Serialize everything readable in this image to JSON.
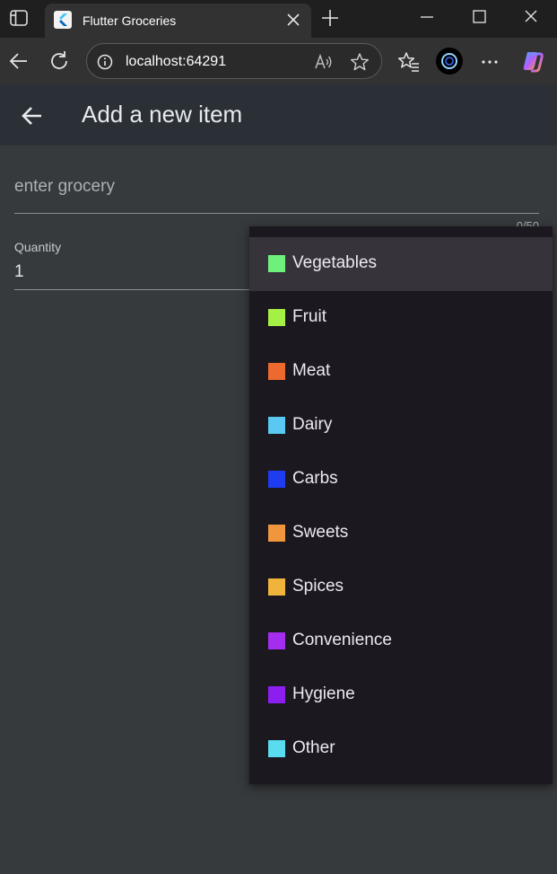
{
  "browser": {
    "tab_title": "Flutter Groceries",
    "url": "localhost:64291"
  },
  "app": {
    "title": "Add a new item",
    "grocery_placeholder": "enter grocery",
    "char_counter": "0/50",
    "quantity_label": "Quantity",
    "quantity_value": "1"
  },
  "menu": {
    "items": [
      {
        "label": "Vegetables",
        "color": "#6ff07d"
      },
      {
        "label": "Fruit",
        "color": "#a5f045"
      },
      {
        "label": "Meat",
        "color": "#ec6a2d"
      },
      {
        "label": "Dairy",
        "color": "#5ac8f0"
      },
      {
        "label": "Carbs",
        "color": "#1e3cf0"
      },
      {
        "label": "Sweets",
        "color": "#f0963c"
      },
      {
        "label": "Spices",
        "color": "#f0b43c"
      },
      {
        "label": "Convenience",
        "color": "#a52df0"
      },
      {
        "label": "Hygiene",
        "color": "#8c1ef0"
      },
      {
        "label": "Other",
        "color": "#5adcf0"
      }
    ]
  }
}
